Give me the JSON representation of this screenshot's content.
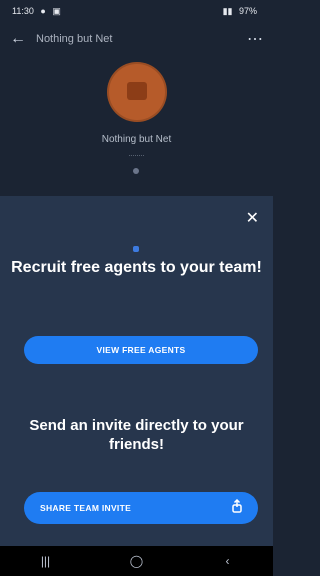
{
  "status_bar": {
    "time": "11:30",
    "left_icons": [
      "notification-dot-icon",
      "image-icon"
    ],
    "right_text": "97%"
  },
  "app_bar": {
    "title": "Nothing but Net"
  },
  "team": {
    "name": "Nothing but Net",
    "subtitle": "........"
  },
  "sheet": {
    "recruit_heading": "Recruit free agents to your team!",
    "view_free_agents": "VIEW FREE AGENTS",
    "invite_heading": "Send an invite directly to your friends!",
    "share_team_invite": "SHARE TEAM INVITE"
  },
  "colors": {
    "sheet_bg": "#27364d",
    "page_bg": "#1b2433",
    "accent": "#1f7cf2",
    "avatar": "#b65b2a"
  },
  "icons": [
    "back-arrow-icon",
    "more-options-icon",
    "close-icon",
    "raised-hand-icon",
    "share-icon",
    "recent-apps-icon",
    "home-icon",
    "back-icon"
  ]
}
